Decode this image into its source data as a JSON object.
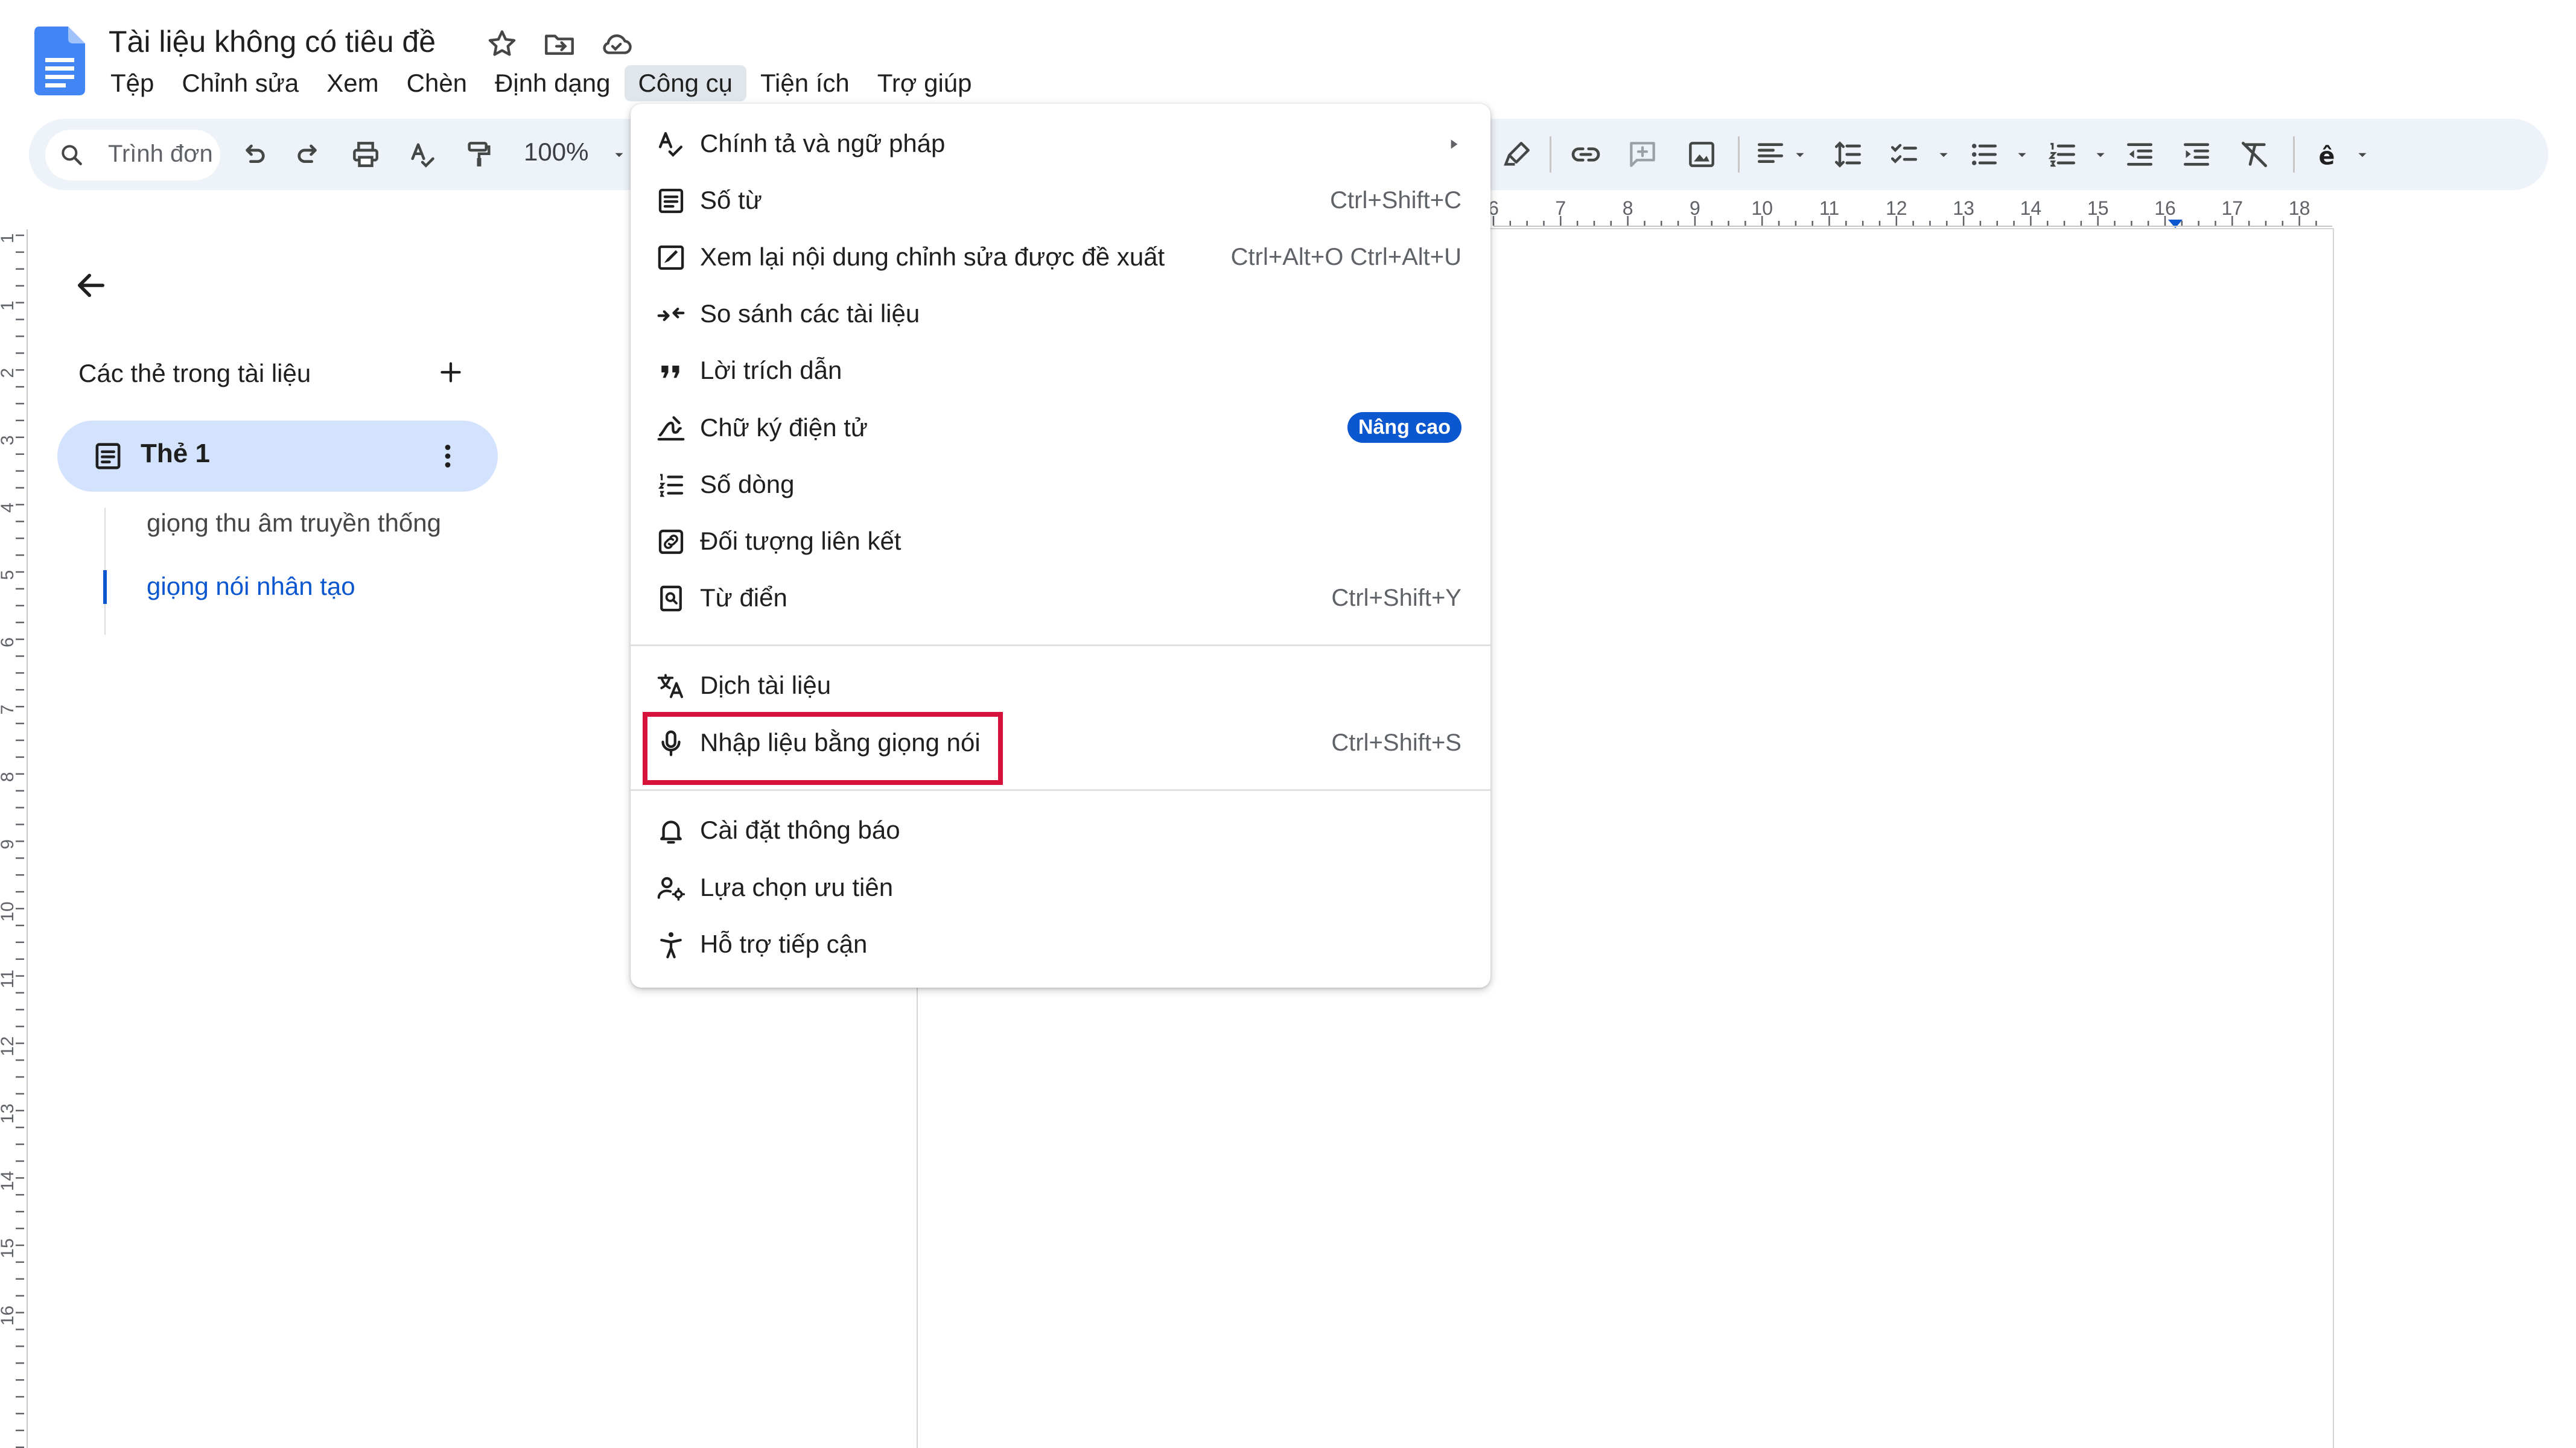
{
  "app": {
    "title": "Tài liệu không có tiêu đề",
    "icons": [
      "star-icon",
      "move-to-folder-icon",
      "cloud-saved-icon"
    ]
  },
  "menubar": {
    "items": [
      "Tệp",
      "Chỉnh sửa",
      "Xem",
      "Chèn",
      "Định dạng",
      "Công cụ",
      "Tiện ích",
      "Trợ giúp"
    ],
    "active": "Công cụ"
  },
  "toolbar": {
    "search_label": "Trình đơn",
    "zoom": "100%"
  },
  "rulers": {
    "horizontal_labels": [
      "6",
      "7",
      "8",
      "9",
      "10",
      "11",
      "12",
      "13",
      "14",
      "15",
      "16",
      "17",
      "18"
    ],
    "vertical_labels": [
      "1",
      "1",
      "2",
      "3",
      "4",
      "5",
      "6",
      "7",
      "8",
      "9",
      "10",
      "11",
      "12",
      "13",
      "14",
      "15",
      "16"
    ]
  },
  "outline": {
    "heading": "Các thẻ trong tài liệu",
    "tab_label": "Thẻ 1",
    "headings": [
      "giọng thu âm truyền thống",
      "giọng nói nhân tạo"
    ],
    "active_heading_index": 1
  },
  "tools_menu": {
    "items": [
      {
        "label": "Chính tả và ngữ pháp",
        "icon": "spellcheck-icon",
        "submenu": "►"
      },
      {
        "label": "Số từ",
        "icon": "word-count-icon",
        "shortcut": "Ctrl+Shift+C"
      },
      {
        "label": "Xem lại nội dung chỉnh sửa được đề xuất",
        "icon": "review-edits-icon",
        "shortcut": "Ctrl+Alt+O Ctrl+Alt+U"
      },
      {
        "label": "So sánh các tài liệu",
        "icon": "compare-icon"
      },
      {
        "label": "Lời trích dẫn",
        "icon": "quote-icon"
      },
      {
        "label": "Chữ ký điện tử",
        "icon": "signature-icon",
        "badge": "Nâng cao"
      },
      {
        "label": "Số dòng",
        "icon": "line-numbers-icon"
      },
      {
        "label": "Đối tượng liên kết",
        "icon": "linked-objects-icon"
      },
      {
        "label": "Từ điển",
        "icon": "dictionary-icon",
        "shortcut": "Ctrl+Shift+Y"
      },
      {
        "label": "Dịch tài liệu",
        "icon": "translate-icon"
      },
      {
        "label": "Nhập liệu bằng giọng nói",
        "icon": "microphone-icon",
        "shortcut": "Ctrl+Shift+S"
      },
      {
        "label": "Cài đặt thông báo",
        "icon": "bell-icon"
      },
      {
        "label": "Lựa chọn ưu tiên",
        "icon": "preferences-icon"
      },
      {
        "label": "Hỗ trợ tiếp cận",
        "icon": "accessibility-icon"
      }
    ],
    "highlighted_item": "Nhập liệu bằng giọng nói"
  },
  "colors": {
    "accent": "#0b57d0",
    "highlight_box": "#d6113a",
    "active_tab_bg": "#d3e3fd",
    "toolbar_bg": "#eef2f9"
  }
}
